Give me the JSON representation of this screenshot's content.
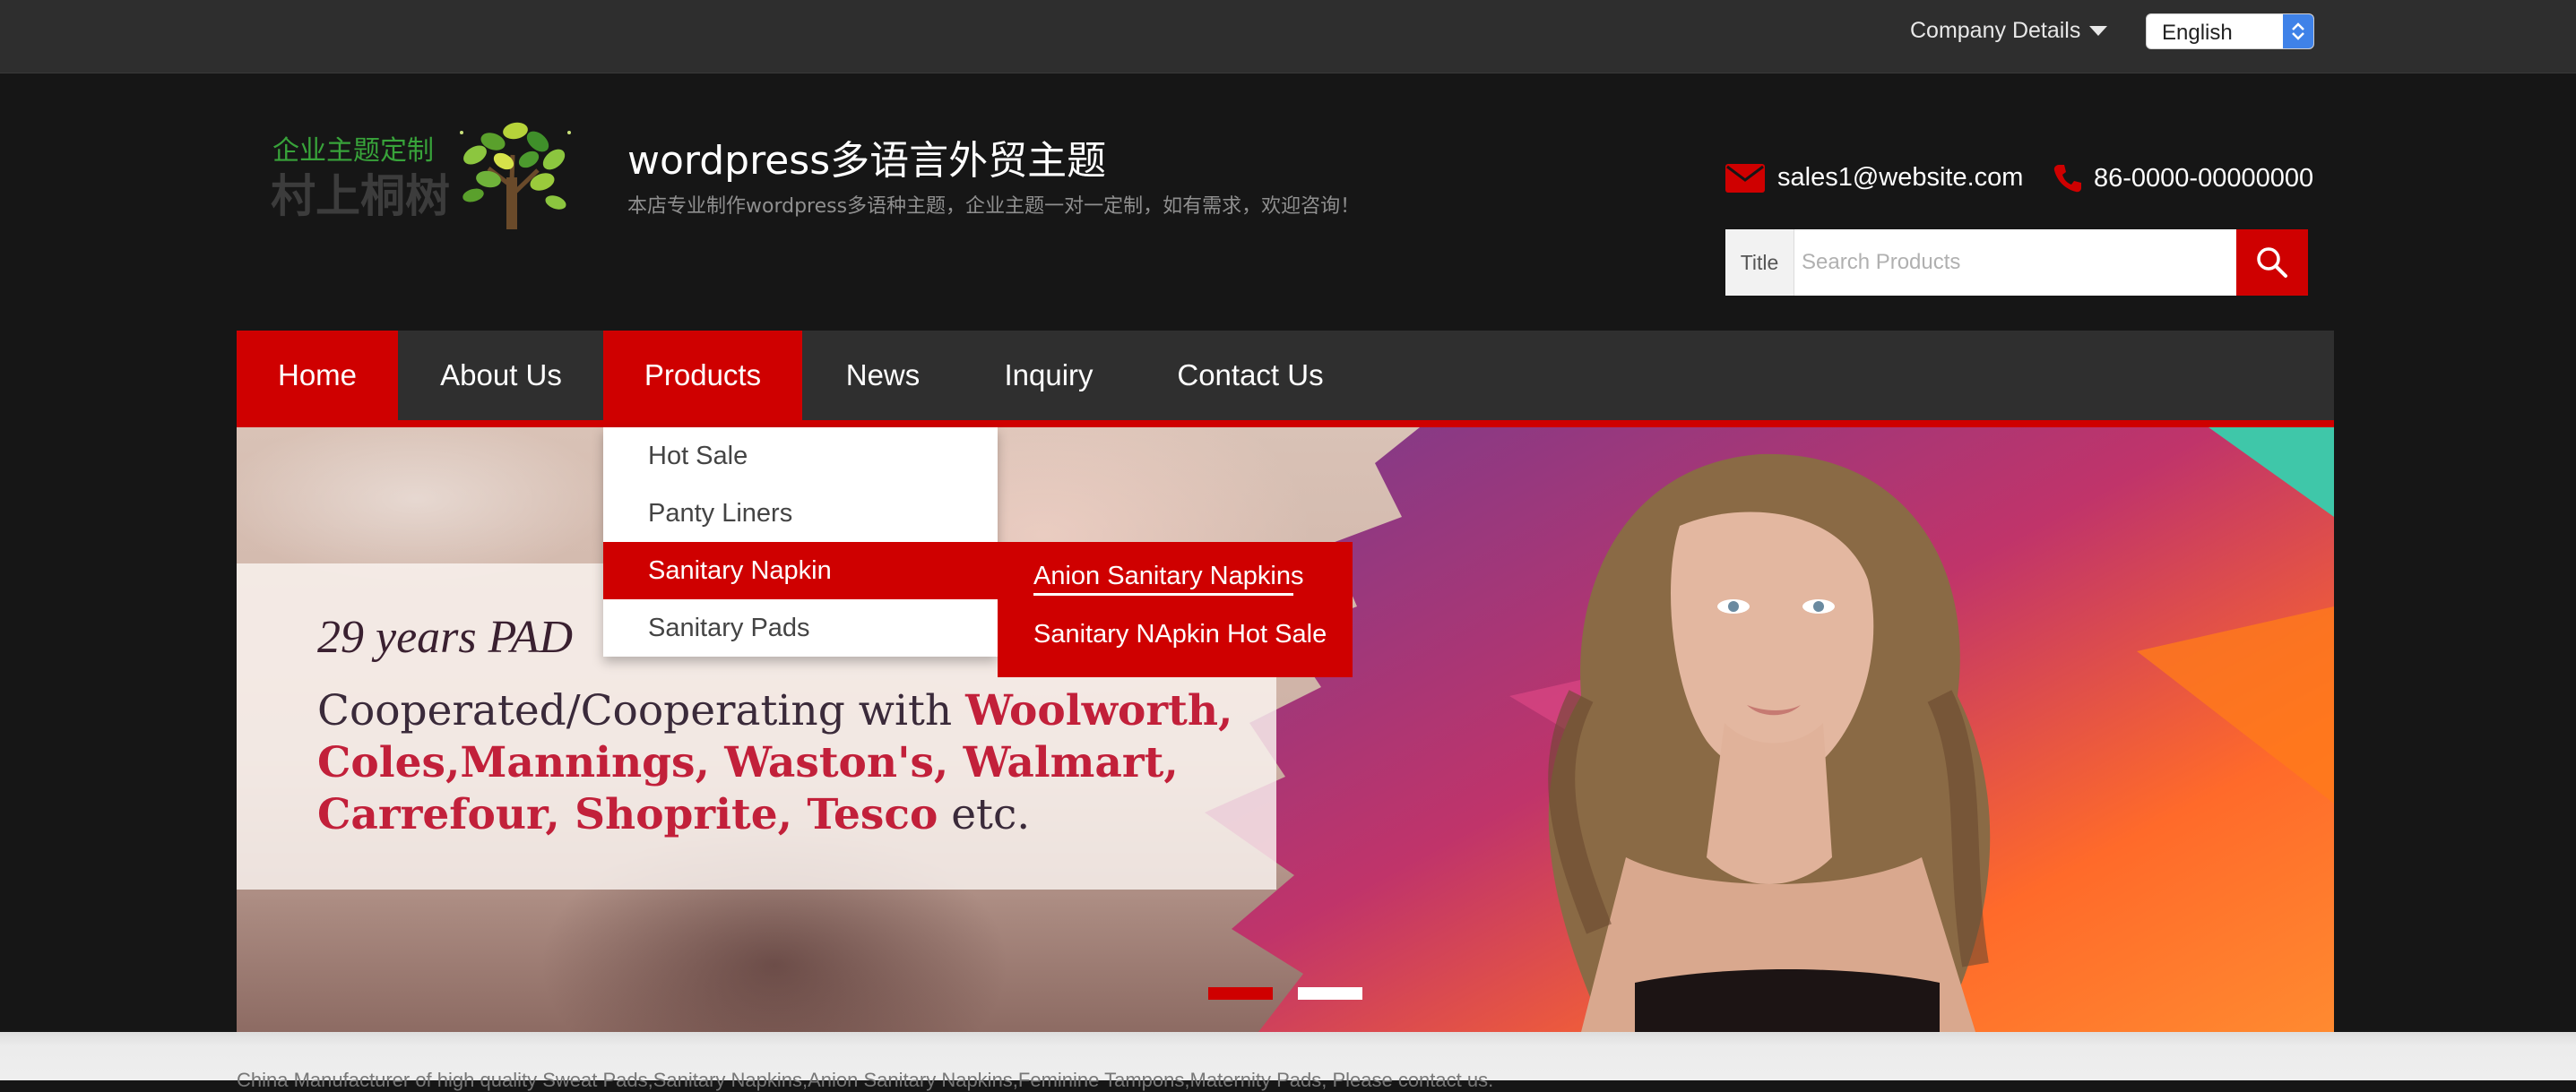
{
  "topbar": {
    "company_details": "Company Details",
    "language": "English"
  },
  "header": {
    "logo_text_top": "企业主题定制",
    "logo_text_bottom": "村上桐树",
    "site_title": "wordpress多语言外贸主题",
    "site_subtitle": "本店专业制作wordpress多语种主题，企业主题一对一定制，如有需求，欢迎咨询！",
    "email": "sales1@website.com",
    "phone": "86-0000-00000000"
  },
  "search": {
    "scope_label": "Title",
    "placeholder": "Search Products"
  },
  "nav": {
    "items": [
      "Home",
      "About Us",
      "Products",
      "News",
      "Inquiry",
      "Contact Us"
    ],
    "active": [
      "Home",
      "Products"
    ]
  },
  "products_menu": {
    "items": [
      "Hot Sale",
      "Panty Liners",
      "Sanitary Napkin",
      "Sanitary Pads"
    ],
    "active": "Sanitary Napkin"
  },
  "sanitary_napkin_submenu": {
    "items": [
      "Anion Sanitary Napkins",
      "Sanitary NApkin Hot Sale"
    ]
  },
  "banner": {
    "line1": "29 years PAD",
    "line2_prefix": "Cooperated/Cooperating with ",
    "line2_brand": "Woolworth,",
    "line3": "Coles,Mannings, Waston's, Walmart,",
    "line4_brands": "Carrefour, Shoprite, Tesco",
    "line4_suffix": " etc.",
    "slides": 2,
    "active_slide": 1
  },
  "footer_strip": {
    "text": "China Manufacturer of high quality Sweat Pads,Sanitary Napkins,Anion Sanitary Napkins,Feminine Tampons,Maternity Pads, Please contact us."
  },
  "colors": {
    "accent": "#cf0000",
    "topbar": "#2e2e2e",
    "header_bg": "#161616",
    "nav_bg": "#2f2f2f",
    "select_button": "#3f82e8"
  },
  "icons": [
    "caret-down-icon",
    "select-arrows-icon",
    "mail-icon",
    "phone-icon",
    "search-icon"
  ]
}
